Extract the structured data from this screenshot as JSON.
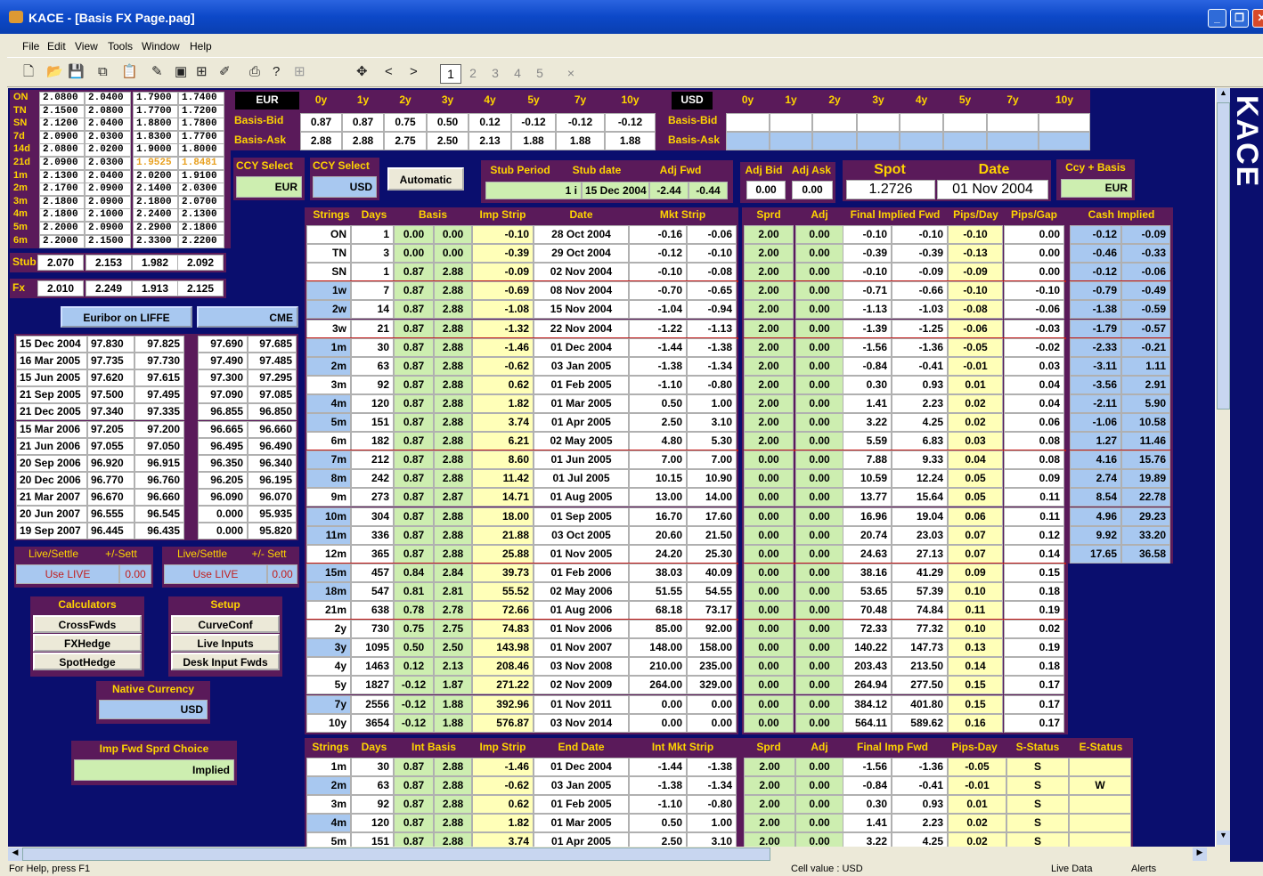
{
  "window": {
    "title": "KACE - [Basis FX Page.pag]"
  },
  "menu": [
    "File",
    "Edit",
    "View",
    "Tools",
    "Window",
    "Help"
  ],
  "toolbar": {
    "pages": [
      "1",
      "2",
      "3",
      "4",
      "5"
    ],
    "close": "×"
  },
  "side_logo": "KACE",
  "status": {
    "help": "For Help, press F1",
    "cell": "Cell value : USD",
    "live": "Live Data",
    "alerts": "Alerts"
  },
  "left_rates": {
    "rows": [
      [
        "ON",
        "2.0800",
        "2.0400",
        "1.7900",
        "1.7400"
      ],
      [
        "TN",
        "2.1500",
        "2.0800",
        "1.7700",
        "1.7200"
      ],
      [
        "SN",
        "2.1200",
        "2.0400",
        "1.8800",
        "1.7800"
      ],
      [
        "7d",
        "2.0900",
        "2.0300",
        "1.8300",
        "1.7700"
      ],
      [
        "14d",
        "2.0800",
        "2.0200",
        "1.9000",
        "1.8000"
      ],
      [
        "21d",
        "2.0900",
        "2.0300",
        "1.9525",
        "1.8481"
      ],
      [
        "1m",
        "2.1300",
        "2.0400",
        "2.0200",
        "1.9100"
      ],
      [
        "2m",
        "2.1700",
        "2.0900",
        "2.1400",
        "2.0300"
      ],
      [
        "3m",
        "2.1800",
        "2.0900",
        "2.1800",
        "2.0700"
      ],
      [
        "4m",
        "2.1800",
        "2.1000",
        "2.2400",
        "2.1300"
      ],
      [
        "5m",
        "2.2000",
        "2.0900",
        "2.2900",
        "2.1800"
      ],
      [
        "6m",
        "2.2000",
        "2.1500",
        "2.3300",
        "2.2200"
      ]
    ],
    "stub": {
      "label": "Stub",
      "v": [
        "2.070",
        "2.153",
        "1.982",
        "2.092"
      ]
    },
    "fx": {
      "label": "Fx",
      "v": [
        "2.010",
        "2.249",
        "1.913",
        "2.125"
      ]
    }
  },
  "euribor": {
    "button": "Euribor on LIFFE",
    "cme": "CME",
    "rows": [
      [
        "15 Dec 2004",
        "97.830",
        "97.825",
        "97.690",
        "97.685"
      ],
      [
        "16 Mar 2005",
        "97.735",
        "97.730",
        "97.490",
        "97.485"
      ],
      [
        "15 Jun 2005",
        "97.620",
        "97.615",
        "97.300",
        "97.295"
      ],
      [
        "21 Sep 2005",
        "97.500",
        "97.495",
        "97.090",
        "97.085"
      ],
      [
        "21 Dec 2005",
        "97.340",
        "97.335",
        "96.855",
        "96.850"
      ],
      [
        "15 Mar 2006",
        "97.205",
        "97.200",
        "96.665",
        "96.660"
      ],
      [
        "21 Jun 2006",
        "97.055",
        "97.050",
        "96.495",
        "96.490"
      ],
      [
        "20 Sep 2006",
        "96.920",
        "96.915",
        "96.350",
        "96.340"
      ],
      [
        "20 Dec 2006",
        "96.770",
        "96.760",
        "96.205",
        "96.195"
      ],
      [
        "21 Mar 2007",
        "96.670",
        "96.660",
        "96.090",
        "96.070"
      ],
      [
        "20 Jun 2007",
        "96.555",
        "96.545",
        "0.000",
        "95.935"
      ],
      [
        "19 Sep 2007",
        "96.445",
        "96.435",
        "0.000",
        "95.820"
      ]
    ],
    "ls1": {
      "a": "Live/Settle",
      "b": "+/-Sett",
      "c": "Use LIVE",
      "d": "0.00"
    },
    "ls2": {
      "a": "Live/Settle",
      "b": "+/- Sett",
      "c": "Use LIVE",
      "d": "0.00"
    }
  },
  "calculators": {
    "title": "Calculators",
    "items": [
      "CrossFwds",
      "FXHedge",
      "SpotHedge"
    ]
  },
  "setup": {
    "title": "Setup",
    "items": [
      "CurveConf",
      "Live Inputs",
      "Desk Input Fwds"
    ]
  },
  "native": {
    "title": "Native Currency",
    "value": "USD"
  },
  "impfwd": {
    "title": "Imp Fwd Sprd Choice",
    "value": "Implied"
  },
  "basis": {
    "tenors": [
      "0y",
      "1y",
      "2y",
      "3y",
      "4y",
      "5y",
      "7y",
      "10y"
    ],
    "bid_label": "Basis-Bid",
    "ask_label": "Basis-Ask",
    "eur": {
      "ccy": "EUR",
      "bid": [
        "0.87",
        "0.87",
        "0.75",
        "0.50",
        "0.12",
        "-0.12",
        "-0.12",
        "-0.12"
      ],
      "ask": [
        "2.88",
        "2.88",
        "2.75",
        "2.50",
        "2.13",
        "1.88",
        "1.88",
        "1.88"
      ]
    },
    "usd": {
      "ccy": "USD"
    }
  },
  "ccy_select": {
    "label1": "CCY Select",
    "value1": "EUR",
    "label2": "CCY Select",
    "value2": "USD",
    "auto": "Automatic"
  },
  "stub": {
    "h": [
      "Stub Period",
      "Stub date",
      "Adj Fwd"
    ],
    "v": [
      "1 i",
      "15 Dec 2004",
      "-2.44",
      "-0.44"
    ]
  },
  "adj": {
    "h": [
      "Adj Bid",
      "Adj Ask"
    ],
    "v": [
      "0.00",
      "0.00"
    ]
  },
  "spot": {
    "h1": "Spot",
    "h2": "Date",
    "spot": "1.2726",
    "date": "01 Nov 2004"
  },
  "ccybasis": {
    "h": "Ccy + Basis",
    "v": "EUR"
  },
  "main_headers": [
    "Strings",
    "Days",
    "Basis",
    "Imp Strip",
    "Date",
    "Mkt Strip",
    "Sprd",
    "Adj",
    "Final Implied Fwd",
    "Pips/Day",
    "Pips/Gap",
    "Cash Implied"
  ],
  "main_rows": [
    [
      "ON",
      "1",
      "0.00",
      "0.00",
      "-0.10",
      "28 Oct 2004",
      "-0.16",
      "-0.06",
      "2.00",
      "0.00",
      "-0.10",
      "-0.10",
      "-0.10",
      "0.00",
      "-0.12",
      "-0.09"
    ],
    [
      "TN",
      "3",
      "0.00",
      "0.00",
      "-0.39",
      "29 Oct 2004",
      "-0.12",
      "-0.10",
      "2.00",
      "0.00",
      "-0.39",
      "-0.39",
      "-0.13",
      "0.00",
      "-0.46",
      "-0.33"
    ],
    [
      "SN",
      "1",
      "0.87",
      "2.88",
      "-0.09",
      "02 Nov 2004",
      "-0.10",
      "-0.08",
      "2.00",
      "0.00",
      "-0.10",
      "-0.09",
      "-0.09",
      "0.00",
      "-0.12",
      "-0.06"
    ],
    [
      "1w",
      "7",
      "0.87",
      "2.88",
      "-0.69",
      "08 Nov 2004",
      "-0.70",
      "-0.65",
      "2.00",
      "0.00",
      "-0.71",
      "-0.66",
      "-0.10",
      "-0.10",
      "-0.79",
      "-0.49"
    ],
    [
      "2w",
      "14",
      "0.87",
      "2.88",
      "-1.08",
      "15 Nov 2004",
      "-1.04",
      "-0.94",
      "2.00",
      "0.00",
      "-1.13",
      "-1.03",
      "-0.08",
      "-0.06",
      "-1.38",
      "-0.59"
    ],
    [
      "3w",
      "21",
      "0.87",
      "2.88",
      "-1.32",
      "22 Nov 2004",
      "-1.22",
      "-1.13",
      "2.00",
      "0.00",
      "-1.39",
      "-1.25",
      "-0.06",
      "-0.03",
      "-1.79",
      "-0.57"
    ],
    [
      "1m",
      "30",
      "0.87",
      "2.88",
      "-1.46",
      "01 Dec 2004",
      "-1.44",
      "-1.38",
      "2.00",
      "0.00",
      "-1.56",
      "-1.36",
      "-0.05",
      "-0.02",
      "-2.33",
      "-0.21"
    ],
    [
      "2m",
      "63",
      "0.87",
      "2.88",
      "-0.62",
      "03 Jan 2005",
      "-1.38",
      "-1.34",
      "2.00",
      "0.00",
      "-0.84",
      "-0.41",
      "-0.01",
      "0.03",
      "-3.11",
      "1.11"
    ],
    [
      "3m",
      "92",
      "0.87",
      "2.88",
      "0.62",
      "01 Feb 2005",
      "-1.10",
      "-0.80",
      "2.00",
      "0.00",
      "0.30",
      "0.93",
      "0.01",
      "0.04",
      "-3.56",
      "2.91"
    ],
    [
      "4m",
      "120",
      "0.87",
      "2.88",
      "1.82",
      "01 Mar 2005",
      "0.50",
      "1.00",
      "2.00",
      "0.00",
      "1.41",
      "2.23",
      "0.02",
      "0.04",
      "-2.11",
      "5.90"
    ],
    [
      "5m",
      "151",
      "0.87",
      "2.88",
      "3.74",
      "01 Apr 2005",
      "2.50",
      "3.10",
      "2.00",
      "0.00",
      "3.22",
      "4.25",
      "0.02",
      "0.06",
      "-1.06",
      "10.58"
    ],
    [
      "6m",
      "182",
      "0.87",
      "2.88",
      "6.21",
      "02 May 2005",
      "4.80",
      "5.30",
      "2.00",
      "0.00",
      "5.59",
      "6.83",
      "0.03",
      "0.08",
      "1.27",
      "11.46"
    ],
    [
      "7m",
      "212",
      "0.87",
      "2.88",
      "8.60",
      "01 Jun 2005",
      "7.00",
      "7.00",
      "0.00",
      "0.00",
      "7.88",
      "9.33",
      "0.04",
      "0.08",
      "4.16",
      "15.76"
    ],
    [
      "8m",
      "242",
      "0.87",
      "2.88",
      "11.42",
      "01 Jul 2005",
      "10.15",
      "10.90",
      "0.00",
      "0.00",
      "10.59",
      "12.24",
      "0.05",
      "0.09",
      "2.74",
      "19.89"
    ],
    [
      "9m",
      "273",
      "0.87",
      "2.87",
      "14.71",
      "01 Aug 2005",
      "13.00",
      "14.00",
      "0.00",
      "0.00",
      "13.77",
      "15.64",
      "0.05",
      "0.11",
      "8.54",
      "22.78"
    ],
    [
      "10m",
      "304",
      "0.87",
      "2.88",
      "18.00",
      "01 Sep 2005",
      "16.70",
      "17.60",
      "0.00",
      "0.00",
      "16.96",
      "19.04",
      "0.06",
      "0.11",
      "4.96",
      "29.23"
    ],
    [
      "11m",
      "336",
      "0.87",
      "2.88",
      "21.88",
      "03 Oct 2005",
      "20.60",
      "21.50",
      "0.00",
      "0.00",
      "20.74",
      "23.03",
      "0.07",
      "0.12",
      "9.92",
      "33.20"
    ],
    [
      "12m",
      "365",
      "0.87",
      "2.88",
      "25.88",
      "01 Nov 2005",
      "24.20",
      "25.30",
      "0.00",
      "0.00",
      "24.63",
      "27.13",
      "0.07",
      "0.14",
      "17.65",
      "36.58"
    ],
    [
      "15m",
      "457",
      "0.84",
      "2.84",
      "39.73",
      "01 Feb 2006",
      "38.03",
      "40.09",
      "0.00",
      "0.00",
      "38.16",
      "41.29",
      "0.09",
      "0.15",
      "",
      ""
    ],
    [
      "18m",
      "547",
      "0.81",
      "2.81",
      "55.52",
      "02 May 2006",
      "51.55",
      "54.55",
      "0.00",
      "0.00",
      "53.65",
      "57.39",
      "0.10",
      "0.18",
      "",
      ""
    ],
    [
      "21m",
      "638",
      "0.78",
      "2.78",
      "72.66",
      "01 Aug 2006",
      "68.18",
      "73.17",
      "0.00",
      "0.00",
      "70.48",
      "74.84",
      "0.11",
      "0.19",
      "",
      ""
    ],
    [
      "2y",
      "730",
      "0.75",
      "2.75",
      "74.83",
      "01 Nov 2006",
      "85.00",
      "92.00",
      "0.00",
      "0.00",
      "72.33",
      "77.32",
      "0.10",
      "0.02",
      "",
      ""
    ],
    [
      "3y",
      "1095",
      "0.50",
      "2.50",
      "143.98",
      "01 Nov 2007",
      "148.00",
      "158.00",
      "0.00",
      "0.00",
      "140.22",
      "147.73",
      "0.13",
      "0.19",
      "",
      ""
    ],
    [
      "4y",
      "1463",
      "0.12",
      "2.13",
      "208.46",
      "03 Nov 2008",
      "210.00",
      "235.00",
      "0.00",
      "0.00",
      "203.43",
      "213.50",
      "0.14",
      "0.18",
      "",
      ""
    ],
    [
      "5y",
      "1827",
      "-0.12",
      "1.87",
      "271.22",
      "02 Nov 2009",
      "264.00",
      "329.00",
      "0.00",
      "0.00",
      "264.94",
      "277.50",
      "0.15",
      "0.17",
      "",
      ""
    ],
    [
      "7y",
      "2556",
      "-0.12",
      "1.88",
      "392.96",
      "01 Nov 2011",
      "0.00",
      "0.00",
      "0.00",
      "0.00",
      "384.12",
      "401.80",
      "0.15",
      "0.17",
      "",
      ""
    ],
    [
      "10y",
      "3654",
      "-0.12",
      "1.88",
      "576.87",
      "03 Nov 2014",
      "0.00",
      "0.00",
      "0.00",
      "0.00",
      "564.11",
      "589.62",
      "0.16",
      "0.17",
      "",
      ""
    ]
  ],
  "bottom_headers": [
    "Strings",
    "Days",
    "Int Basis",
    "Imp Strip",
    "End Date",
    "Int Mkt Strip",
    "Sprd",
    "Adj",
    "Final Imp Fwd",
    "Pips-Day",
    "S-Status",
    "E-Status"
  ],
  "bottom_rows": [
    [
      "1m",
      "30",
      "0.87",
      "2.88",
      "-1.46",
      "01 Dec 2004",
      "-1.44",
      "-1.38",
      "2.00",
      "0.00",
      "-1.56",
      "-1.36",
      "-0.05",
      "S",
      ""
    ],
    [
      "2m",
      "63",
      "0.87",
      "2.88",
      "-0.62",
      "03 Jan 2005",
      "-1.38",
      "-1.34",
      "2.00",
      "0.00",
      "-0.84",
      "-0.41",
      "-0.01",
      "S",
      "W"
    ],
    [
      "3m",
      "92",
      "0.87",
      "2.88",
      "0.62",
      "01 Feb 2005",
      "-1.10",
      "-0.80",
      "2.00",
      "0.00",
      "0.30",
      "0.93",
      "0.01",
      "S",
      ""
    ],
    [
      "4m",
      "120",
      "0.87",
      "2.88",
      "1.82",
      "01 Mar 2005",
      "0.50",
      "1.00",
      "2.00",
      "0.00",
      "1.41",
      "2.23",
      "0.02",
      "S",
      ""
    ],
    [
      "5m",
      "151",
      "0.87",
      "2.88",
      "3.74",
      "01 Apr 2005",
      "2.50",
      "3.10",
      "2.00",
      "0.00",
      "3.22",
      "4.25",
      "0.02",
      "S",
      ""
    ]
  ]
}
